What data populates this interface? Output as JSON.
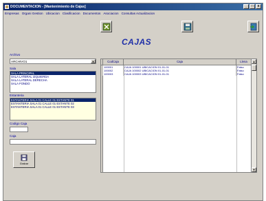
{
  "window": {
    "title": "DOCUMENTACION - [Mantenimiento de Cajas]",
    "minimize": "_",
    "maximize": "□",
    "close": "x"
  },
  "menu": [
    "Empresas",
    "Organi Gestion",
    "Ubicacion",
    "Clasificacion",
    "Documentos",
    "Asociacion",
    "Consultas Actualizacion"
  ],
  "toolbar": {
    "delete_icon": "delete-icon",
    "save_icon": "save-icon",
    "exit_icon": "exit-icon"
  },
  "page_title": "CAJAS",
  "form": {
    "archivo_label": "Archivo",
    "archivo_value": "ARCHIVO1",
    "sala_label": "Sala",
    "salas": [
      {
        "text": "SALA PRINCIPAL",
        "selected": true
      },
      {
        "text": "SALA LATERAL IZQUIERDA",
        "selected": false
      },
      {
        "text": "SALA LATERAL DERECHA",
        "selected": false
      },
      {
        "text": "SALA FONDO",
        "selected": false
      }
    ],
    "estanteria_label": "Estanteria",
    "estanterias": [
      {
        "text": "ESTANTERIA SALA 01 CALLE 01 ESTANTE 01",
        "selected": true
      },
      {
        "text": "ESTANTERIA SALA 01 CALLE 01 ESTANTE 02",
        "selected": false
      },
      {
        "text": "ESTANTERIA SALA 01 CALLE 01 ESTANTE 03",
        "selected": false
      }
    ],
    "codigo_caja_label": "Codigo Caja",
    "codigo_caja_value": "",
    "caja_label": "Caja",
    "caja_value": "",
    "grabar_label": "Grabar"
  },
  "grid": {
    "columns": [
      "CodCaja",
      "Caja",
      "Llena"
    ],
    "rows": [
      [
        "100001",
        "CAJA 100001 UBICACION 01-01-01",
        "Falso"
      ],
      [
        "100002",
        "CAJA 100002 UBICACION 01-01-01",
        "Falso"
      ],
      [
        "100003",
        "CAJA 100003 UBICACION 01-01-01",
        "Falso"
      ]
    ]
  }
}
